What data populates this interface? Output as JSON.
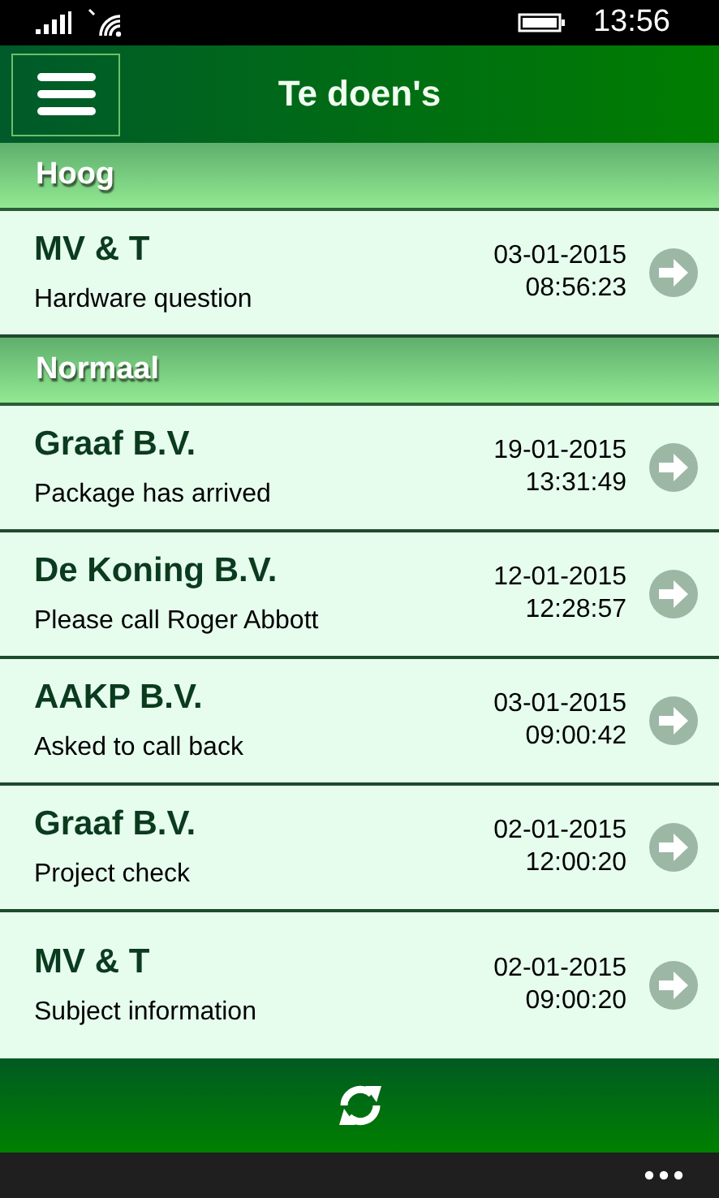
{
  "status_bar": {
    "time": "13:56"
  },
  "header": {
    "title": "Te doen's"
  },
  "sections": [
    {
      "title": "Hoog",
      "items": [
        {
          "name": "MV & T",
          "subject": "Hardware question",
          "date": "03-01-2015",
          "time": "08:56:23"
        }
      ]
    },
    {
      "title": "Normaal",
      "items": [
        {
          "name": "Graaf B.V.",
          "subject": "Package has arrived",
          "date": "19-01-2015",
          "time": "13:31:49"
        },
        {
          "name": "De Koning B.V.",
          "subject": "Please call Roger Abbott",
          "date": "12-01-2015",
          "time": "12:28:57"
        },
        {
          "name": "AAKP B.V.",
          "subject": "Asked to call back",
          "date": "03-01-2015",
          "time": "09:00:42"
        },
        {
          "name": "Graaf B.V.",
          "subject": "Project check",
          "date": "02-01-2015",
          "time": "12:00:20"
        },
        {
          "name": "MV & T",
          "subject": "Subject information",
          "date": "02-01-2015",
          "time": "09:00:20"
        }
      ]
    }
  ]
}
